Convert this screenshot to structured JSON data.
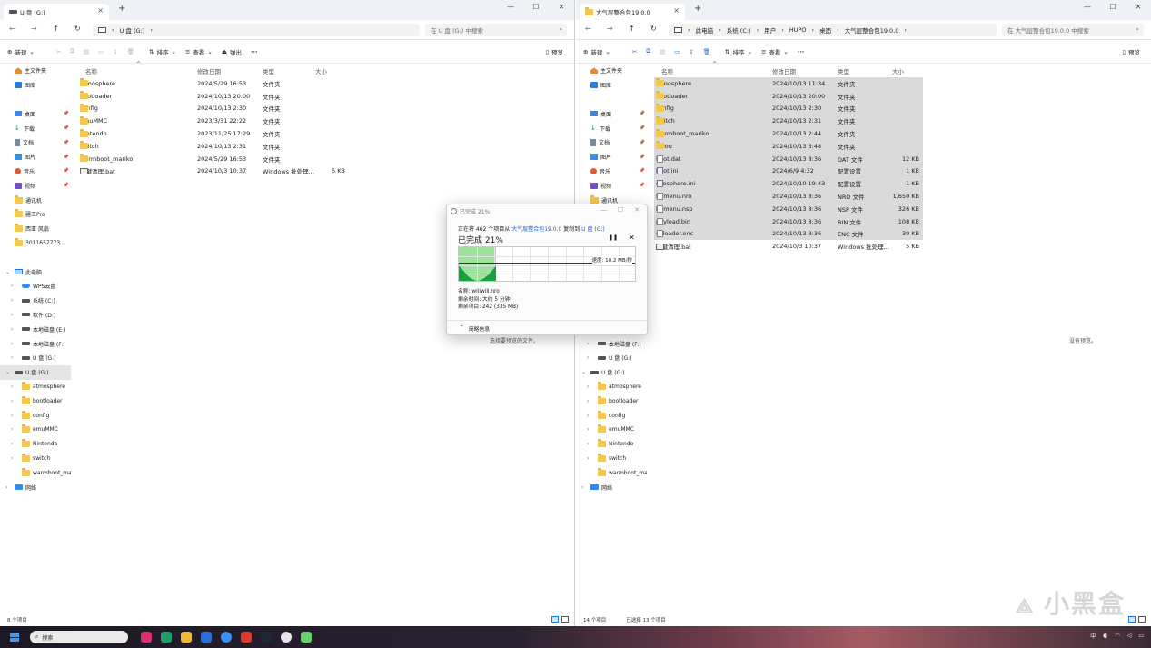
{
  "left": {
    "tab_title": "U 盘 (G:)",
    "address": [
      "U 盘 (G:)"
    ],
    "search_placeholder": "在 U 盘 (G:) 中搜索",
    "toolbar": {
      "new": "新建",
      "sort": "排序",
      "view": "查看",
      "eject": "弹出",
      "more": "···",
      "preview": "预览"
    },
    "columns": {
      "name": "名称",
      "date": "修改日期",
      "type": "类型",
      "size": "大小"
    },
    "files": [
      {
        "name": "atmosphere",
        "date": "2024/5/29 16:53",
        "type": "文件夹",
        "size": "",
        "icon": "folder"
      },
      {
        "name": "bootloader",
        "date": "2024/10/13 20:00",
        "type": "文件夹",
        "size": "",
        "icon": "folder"
      },
      {
        "name": "config",
        "date": "2024/10/13 2:30",
        "type": "文件夹",
        "size": "",
        "icon": "folder"
      },
      {
        "name": "emuMMC",
        "date": "2023/3/31 22:22",
        "type": "文件夹",
        "size": "",
        "icon": "folder"
      },
      {
        "name": "Nintendo",
        "date": "2023/11/25 17:29",
        "type": "文件夹",
        "size": "",
        "icon": "folder"
      },
      {
        "name": "switch",
        "date": "2024/10/13 2:31",
        "type": "文件夹",
        "size": "",
        "icon": "folder"
      },
      {
        "name": "warmboot_mariko",
        "date": "2024/5/29 16:53",
        "type": "文件夹",
        "size": "",
        "icon": "folder"
      },
      {
        "name": "一键清理.bat",
        "date": "2024/10/3 10:37",
        "type": "Windows 批处理...",
        "size": "5 KB",
        "icon": "bat"
      }
    ],
    "nav": [
      {
        "label": "主文件夹",
        "icon": "home",
        "sub": false,
        "chev": "",
        "pin": false
      },
      {
        "label": "图库",
        "icon": "gallery",
        "sub": false,
        "chev": "",
        "pin": false
      },
      {
        "label": "",
        "icon": "",
        "sub": false,
        "chev": "",
        "pin": false
      },
      {
        "label": "桌面",
        "icon": "desk",
        "sub": false,
        "chev": "",
        "pin": true
      },
      {
        "label": "下载",
        "icon": "down",
        "sub": false,
        "chev": "",
        "pin": true
      },
      {
        "label": "文档",
        "icon": "doc",
        "sub": false,
        "chev": "",
        "pin": true
      },
      {
        "label": "图片",
        "icon": "pic",
        "sub": false,
        "chev": "",
        "pin": true
      },
      {
        "label": "音乐",
        "icon": "music",
        "sub": false,
        "chev": "",
        "pin": true
      },
      {
        "label": "视频",
        "icon": "video",
        "sub": false,
        "chev": "",
        "pin": true
      },
      {
        "label": "通讯机",
        "icon": "folder",
        "sub": false,
        "chev": "",
        "pin": false
      },
      {
        "label": "疆王Pro",
        "icon": "folder",
        "sub": false,
        "chev": "",
        "pin": false
      },
      {
        "label": "西亚 风扇",
        "icon": "folder",
        "sub": false,
        "chev": "",
        "pin": false
      },
      {
        "label": "3011657773",
        "icon": "folder",
        "sub": false,
        "chev": "",
        "pin": false
      },
      {
        "label": "",
        "icon": "",
        "sub": false,
        "chev": "",
        "pin": false
      },
      {
        "label": "此电脑",
        "icon": "pc",
        "sub": false,
        "chev": "v",
        "pin": false
      },
      {
        "label": "WPS云盘",
        "icon": "cloud",
        "sub": true,
        "chev": ">",
        "pin": false
      },
      {
        "label": "系统 (C:)",
        "icon": "drive",
        "sub": true,
        "chev": ">",
        "pin": false
      },
      {
        "label": "软件 (D:)",
        "icon": "drive",
        "sub": true,
        "chev": ">",
        "pin": false
      },
      {
        "label": "本地磁盘 (E:)",
        "icon": "drive",
        "sub": true,
        "chev": ">",
        "pin": false
      },
      {
        "label": "本地磁盘 (F:)",
        "icon": "drive",
        "sub": true,
        "chev": ">",
        "pin": false
      },
      {
        "label": "U 盘 (G:)",
        "icon": "drive",
        "sub": true,
        "chev": ">",
        "pin": false
      },
      {
        "label": "U 盘 (G:)",
        "icon": "drive",
        "sub": false,
        "chev": "v",
        "pin": false,
        "selected": true
      },
      {
        "label": "atmosphere",
        "icon": "folder",
        "sub": true,
        "chev": ">",
        "pin": false
      },
      {
        "label": "bootloader",
        "icon": "folder",
        "sub": true,
        "chev": ">",
        "pin": false
      },
      {
        "label": "config",
        "icon": "folder",
        "sub": true,
        "chev": ">",
        "pin": false
      },
      {
        "label": "emuMMC",
        "icon": "folder",
        "sub": true,
        "chev": ">",
        "pin": false
      },
      {
        "label": "Nintendo",
        "icon": "folder",
        "sub": true,
        "chev": ">",
        "pin": false
      },
      {
        "label": "switch",
        "icon": "folder",
        "sub": true,
        "chev": ">",
        "pin": false
      },
      {
        "label": "warmboot_maril",
        "icon": "folder",
        "sub": true,
        "chev": "",
        "pin": false
      },
      {
        "label": "网络",
        "icon": "net",
        "sub": false,
        "chev": ">",
        "pin": false
      }
    ],
    "status": [
      "8 个项目"
    ],
    "preview_msg": "选择要预览的文件。"
  },
  "right": {
    "tab_title": "大气层整合包19.0.0",
    "address": [
      "此电脑",
      "系统 (C:)",
      "用户",
      "HUPO",
      "桌面",
      "大气层整合包19.0.0"
    ],
    "search_placeholder": "在 大气层整合包19.0.0 中搜索",
    "toolbar": {
      "new": "新建",
      "sort": "排序",
      "view": "查看",
      "more": "···",
      "preview": "预览"
    },
    "columns": {
      "name": "名称",
      "date": "修改日期",
      "type": "类型",
      "size": "大小"
    },
    "files": [
      {
        "name": "atmosphere",
        "date": "2024/10/13 11:34",
        "type": "文件夹",
        "size": "",
        "icon": "folder",
        "sel": true
      },
      {
        "name": "bootloader",
        "date": "2024/10/13 20:00",
        "type": "文件夹",
        "size": "",
        "icon": "folder",
        "sel": true
      },
      {
        "name": "config",
        "date": "2024/10/13 2:30",
        "type": "文件夹",
        "size": "",
        "icon": "folder",
        "sel": true
      },
      {
        "name": "switch",
        "date": "2024/10/13 2:31",
        "type": "文件夹",
        "size": "",
        "icon": "folder",
        "sel": true
      },
      {
        "name": "warmboot_mariko",
        "date": "2024/10/13 2:44",
        "type": "文件夹",
        "size": "",
        "icon": "folder",
        "sel": true
      },
      {
        "name": "xidou",
        "date": "2024/10/13 3:48",
        "type": "文件夹",
        "size": "",
        "icon": "folder",
        "sel": true
      },
      {
        "name": "boot.dat",
        "date": "2024/10/13 8:36",
        "type": "DAT 文件",
        "size": "12 KB",
        "icon": "file",
        "sel": true
      },
      {
        "name": "boot.ini",
        "date": "2024/6/9 4:32",
        "type": "配置设置",
        "size": "1 KB",
        "icon": "gear",
        "sel": true
      },
      {
        "name": "exosphere.ini",
        "date": "2024/10/10 19:43",
        "type": "配置设置",
        "size": "1 KB",
        "icon": "gear",
        "sel": true
      },
      {
        "name": "hbmenu.nro",
        "date": "2024/10/13 8:36",
        "type": "NRO 文件",
        "size": "1,650 KB",
        "icon": "file",
        "sel": true
      },
      {
        "name": "hbmenu.nsp",
        "date": "2024/10/13 8:36",
        "type": "NSP 文件",
        "size": "326 KB",
        "icon": "file",
        "sel": true
      },
      {
        "name": "payload.bin",
        "date": "2024/10/13 8:36",
        "type": "BIN 文件",
        "size": "108 KB",
        "icon": "file",
        "sel": true
      },
      {
        "name": "sdloader.enc",
        "date": "2024/10/13 8:36",
        "type": "ENC 文件",
        "size": "30 KB",
        "icon": "file",
        "sel": true
      },
      {
        "name": "一键清理.bat",
        "date": "2024/10/3 10:37",
        "type": "Windows 批处理...",
        "size": "5 KB",
        "icon": "bat",
        "sel": false
      }
    ],
    "nav": [
      {
        "label": "主文件夹",
        "icon": "home",
        "sub": false,
        "chev": "",
        "pin": false
      },
      {
        "label": "图库",
        "icon": "gallery",
        "sub": false,
        "chev": "",
        "pin": false
      },
      {
        "label": "",
        "icon": "",
        "sub": false,
        "chev": "",
        "pin": false
      },
      {
        "label": "桌面",
        "icon": "desk",
        "sub": false,
        "chev": "",
        "pin": true
      },
      {
        "label": "下载",
        "icon": "down",
        "sub": false,
        "chev": "",
        "pin": true
      },
      {
        "label": "文档",
        "icon": "doc",
        "sub": false,
        "chev": "",
        "pin": true
      },
      {
        "label": "图片",
        "icon": "pic",
        "sub": false,
        "chev": "",
        "pin": true
      },
      {
        "label": "音乐",
        "icon": "music",
        "sub": false,
        "chev": "",
        "pin": true
      },
      {
        "label": "视频",
        "icon": "video",
        "sub": false,
        "chev": "",
        "pin": true
      },
      {
        "label": "通讯机",
        "icon": "folder",
        "sub": false,
        "chev": "",
        "pin": false
      },
      {
        "label": "",
        "icon": "",
        "sub": false,
        "chev": "",
        "pin": false
      },
      {
        "label": "",
        "icon": "",
        "sub": false,
        "chev": "",
        "pin": false
      },
      {
        "label": "",
        "icon": "",
        "sub": false,
        "chev": "",
        "pin": false
      },
      {
        "label": "",
        "icon": "",
        "sub": false,
        "chev": "",
        "pin": false
      },
      {
        "label": "",
        "icon": "",
        "sub": false,
        "chev": "",
        "pin": false
      },
      {
        "label": "",
        "icon": "",
        "sub": false,
        "chev": "",
        "pin": false
      },
      {
        "label": "",
        "icon": "",
        "sub": false,
        "chev": "",
        "pin": false
      },
      {
        "label": "",
        "icon": "",
        "sub": false,
        "chev": "",
        "pin": false
      },
      {
        "label": "",
        "icon": "",
        "sub": false,
        "chev": "",
        "pin": false
      },
      {
        "label": "本地磁盘 (F:)",
        "icon": "drive",
        "sub": true,
        "chev": ">",
        "pin": false
      },
      {
        "label": "U 盘 (G:)",
        "icon": "drive",
        "sub": true,
        "chev": ">",
        "pin": false
      },
      {
        "label": "U 盘 (G:)",
        "icon": "drive",
        "sub": false,
        "chev": "v",
        "pin": false
      },
      {
        "label": "atmosphere",
        "icon": "folder",
        "sub": true,
        "chev": ">",
        "pin": false
      },
      {
        "label": "bootloader",
        "icon": "folder",
        "sub": true,
        "chev": ">",
        "pin": false
      },
      {
        "label": "config",
        "icon": "folder",
        "sub": true,
        "chev": ">",
        "pin": false
      },
      {
        "label": "emuMMC",
        "icon": "folder",
        "sub": true,
        "chev": ">",
        "pin": false
      },
      {
        "label": "Nintendo",
        "icon": "folder",
        "sub": true,
        "chev": ">",
        "pin": false
      },
      {
        "label": "switch",
        "icon": "folder",
        "sub": true,
        "chev": ">",
        "pin": false
      },
      {
        "label": "warmboot_maril",
        "icon": "folder",
        "sub": true,
        "chev": "",
        "pin": false
      },
      {
        "label": "网络",
        "icon": "net",
        "sub": false,
        "chev": ">",
        "pin": false
      }
    ],
    "status": [
      "14 个项目",
      "已选择 13 个项目"
    ],
    "preview_msg": "没有预览。"
  },
  "dialog": {
    "title": "已完成 21%",
    "line_prefix": "正在将 462 个项目从",
    "source": "大气层整合包19.0.0",
    "line_mid": "复制到",
    "dest": "U 盘 (G:)",
    "percent_label": "已完成 21%",
    "progress": 0.21,
    "speed": "速度: 10.2 MB/秒",
    "name_line": "名称: wiliwili.nro",
    "time_line": "剩余时间: 大约 5 分钟",
    "items_line": "剩余项目: 242 (335 MB)",
    "more_label": "简略信息"
  },
  "taskbar": {
    "search": "搜索",
    "ime": "中",
    "accent": "#3a9bf0"
  },
  "watermark": "小黑盒"
}
